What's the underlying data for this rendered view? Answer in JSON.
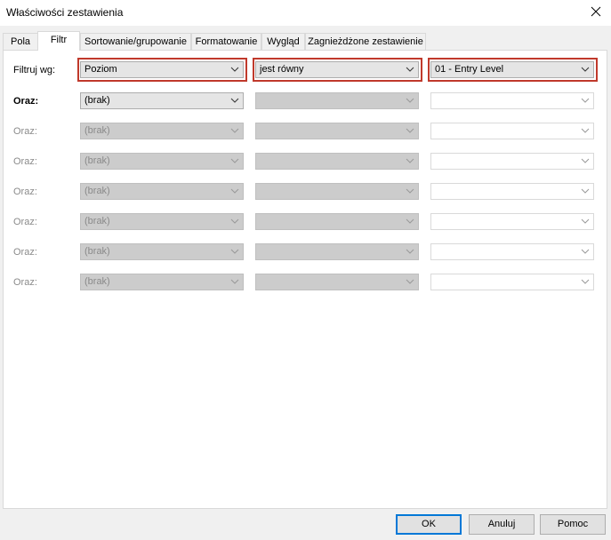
{
  "window": {
    "title": "Właściwości zestawienia"
  },
  "tabs": [
    {
      "label": "Pola"
    },
    {
      "label": "Filtr"
    },
    {
      "label": "Sortowanie/grupowanie"
    },
    {
      "label": "Formatowanie"
    },
    {
      "label": "Wygląd"
    },
    {
      "label": "Zagnieżdżone zestawienie"
    }
  ],
  "filter": {
    "rows": [
      {
        "label": "Filtruj wg:",
        "field": "Poziom",
        "operator": "jest równy",
        "value": "01 - Entry Level"
      },
      {
        "label": "Oraz:",
        "field": "(brak)",
        "operator": "",
        "value": ""
      },
      {
        "label": "Oraz:",
        "field": "(brak)",
        "operator": "",
        "value": ""
      },
      {
        "label": "Oraz:",
        "field": "(brak)",
        "operator": "",
        "value": ""
      },
      {
        "label": "Oraz:",
        "field": "(brak)",
        "operator": "",
        "value": ""
      },
      {
        "label": "Oraz:",
        "field": "(brak)",
        "operator": "",
        "value": ""
      },
      {
        "label": "Oraz:",
        "field": "(brak)",
        "operator": "",
        "value": ""
      },
      {
        "label": "Oraz:",
        "field": "(brak)",
        "operator": "",
        "value": ""
      }
    ]
  },
  "buttons": {
    "ok": "OK",
    "cancel": "Anuluj",
    "help": "Pomoc"
  },
  "colors": {
    "highlight": "#c0392b",
    "default_button_border": "#0078d7"
  },
  "icons": {
    "close": "close-icon",
    "dropdown": "chevron-down-icon"
  }
}
